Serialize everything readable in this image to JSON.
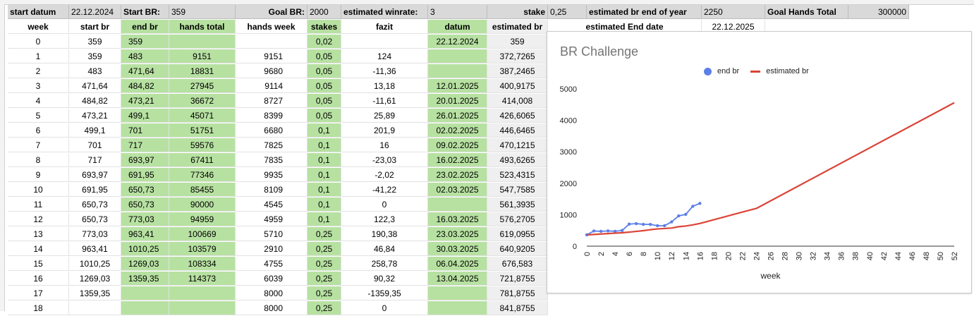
{
  "header": {
    "start_datum_label": "start datum",
    "start_datum_value": "22.12.2024",
    "start_br_label": "Start BR:",
    "start_br_value": "359",
    "goal_br_label": "Goal BR:",
    "goal_br_value": "2000",
    "winrate_label": "estimated winrate:",
    "winrate_value": "3",
    "stake_label": "stake",
    "stake_value": "0,25",
    "br_end_year_label": "estimated br end of year",
    "br_end_year_value": "2250",
    "goal_hands_label": "Goal Hands Total",
    "goal_hands_value": "300000"
  },
  "columns": [
    "week",
    "start br",
    "end br",
    "hands total",
    "hands week",
    "stakes",
    "fazit",
    "datum",
    "estimated br"
  ],
  "end_date": {
    "label": "estimated End date",
    "value": "22.12.2025"
  },
  "rows": [
    [
      "0",
      "359",
      "359",
      "",
      "",
      "0,02",
      "",
      "22.12.2024",
      "359"
    ],
    [
      "1",
      "359",
      "483",
      "9151",
      "9151",
      "0,05",
      "124",
      "",
      "372,7265"
    ],
    [
      "2",
      "483",
      "471,64",
      "18831",
      "9680",
      "0,05",
      "-11,36",
      "",
      "387,2465"
    ],
    [
      "3",
      "471,64",
      "484,82",
      "27945",
      "9114",
      "0,05",
      "13,18",
      "12.01.2025",
      "400,9175"
    ],
    [
      "4",
      "484,82",
      "473,21",
      "36672",
      "8727",
      "0,05",
      "-11,61",
      "20.01.2025",
      "414,008"
    ],
    [
      "5",
      "473,21",
      "499,1",
      "45071",
      "8399",
      "0,05",
      "25,89",
      "26.01.2025",
      "426,6065"
    ],
    [
      "6",
      "499,1",
      "701",
      "51751",
      "6680",
      "0,1",
      "201,9",
      "02.02.2025",
      "446,6465"
    ],
    [
      "7",
      "701",
      "717",
      "59576",
      "7825",
      "0,1",
      "16",
      "09.02.2025",
      "470,1215"
    ],
    [
      "8",
      "717",
      "693,97",
      "67411",
      "7835",
      "0,1",
      "-23,03",
      "16.02.2025",
      "493,6265"
    ],
    [
      "9",
      "693,97",
      "691,95",
      "77346",
      "9935",
      "0,1",
      "-2,02",
      "23.02.2025",
      "523,4315"
    ],
    [
      "10",
      "691,95",
      "650,73",
      "85455",
      "8109",
      "0,1",
      "-41,22",
      "02.03.2025",
      "547,7585"
    ],
    [
      "11",
      "650,73",
      "650,73",
      "90000",
      "4545",
      "0,1",
      "0",
      "",
      "561,3935"
    ],
    [
      "12",
      "650,73",
      "773,03",
      "94959",
      "4959",
      "0,1",
      "122,3",
      "16.03.2025",
      "576,2705"
    ],
    [
      "13",
      "773,03",
      "963,41",
      "100669",
      "5710",
      "0,25",
      "190,38",
      "23.03.2025",
      "619,0955"
    ],
    [
      "14",
      "963,41",
      "1010,25",
      "103579",
      "2910",
      "0,25",
      "46,84",
      "30.03.2025",
      "640,9205"
    ],
    [
      "15",
      "1010,25",
      "1269,03",
      "108334",
      "4755",
      "0,25",
      "258,78",
      "06.04.2025",
      "676,583"
    ],
    [
      "16",
      "1269,03",
      "1359,35",
      "114373",
      "6039",
      "0,25",
      "90,32",
      "13.04.2025",
      "721,8755"
    ],
    [
      "17",
      "1359,35",
      "",
      "",
      "8000",
      "0,25",
      "-1359,35",
      "",
      "781,8755"
    ],
    [
      "18",
      "",
      "",
      "",
      "8000",
      "0,25",
      "0",
      "",
      "841,8755"
    ]
  ],
  "chart_data": {
    "type": "line",
    "title": "BR Challenge",
    "xlabel": "week",
    "ylabel": "",
    "ylim": [
      0,
      5000
    ],
    "xlim": [
      0,
      52
    ],
    "yticks": [
      0,
      1000,
      2000,
      3000,
      4000,
      5000
    ],
    "xticks": [
      "0",
      "2",
      "4",
      "6",
      "8",
      "10",
      "12",
      "14",
      "16",
      "18",
      "20",
      "22",
      "24",
      "26",
      "28",
      "30",
      "32",
      "34",
      "36",
      "38",
      "40",
      "42",
      "44",
      "46",
      "48",
      "50",
      "52"
    ],
    "legend_position": "top",
    "series": [
      {
        "name": "end br",
        "color": "#5b7fe8",
        "marker": "dot",
        "x": [
          0,
          1,
          2,
          3,
          4,
          5,
          6,
          7,
          8,
          9,
          10,
          11,
          12,
          13,
          14,
          15,
          16
        ],
        "y": [
          359,
          483,
          471.64,
          484.82,
          473.21,
          499.1,
          701,
          717,
          693.97,
          691.95,
          650.73,
          650.73,
          773.03,
          963.41,
          1010.25,
          1269.03,
          1359.35
        ]
      },
      {
        "name": "estimated br",
        "color": "#db4437",
        "marker": "line",
        "x": [
          0,
          1,
          2,
          3,
          4,
          5,
          6,
          7,
          8,
          9,
          10,
          11,
          12,
          13,
          14,
          15,
          16,
          17,
          18,
          20,
          22,
          24,
          52
        ],
        "y": [
          359,
          372.73,
          387.25,
          400.92,
          414.01,
          426.61,
          446.65,
          470.12,
          493.63,
          523.43,
          547.76,
          561.39,
          576.27,
          619.1,
          640.92,
          676.58,
          721.88,
          781.88,
          841.88,
          961.88,
          1081.88,
          1200,
          4560
        ]
      }
    ]
  }
}
